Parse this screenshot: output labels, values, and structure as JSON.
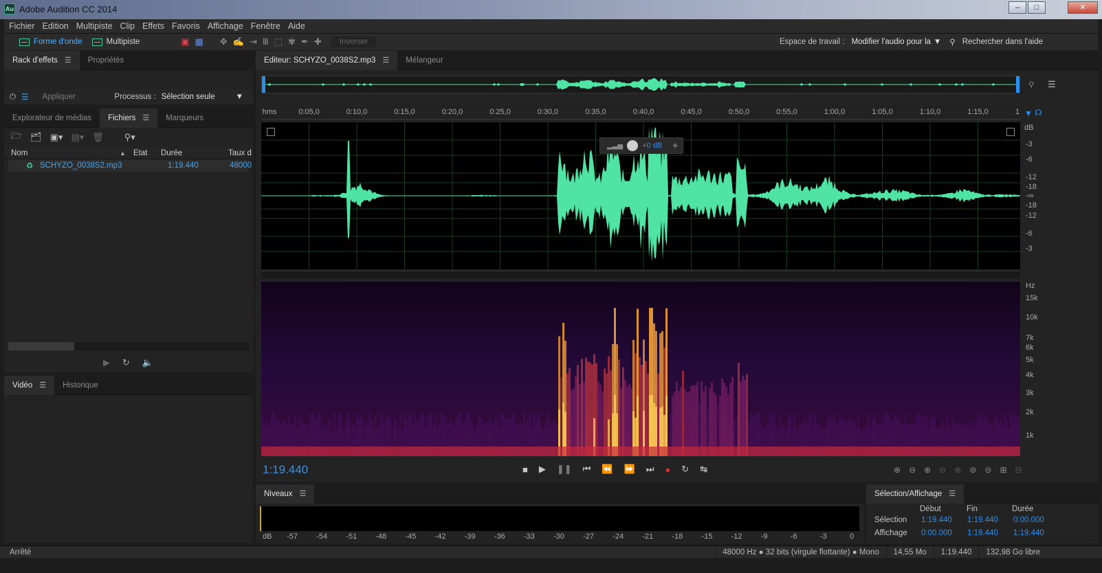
{
  "window": {
    "title": "Adobe Audition CC 2014",
    "icon_text": "Au",
    "controls": [
      "minimize-icon",
      "maximize-icon",
      "close-icon"
    ]
  },
  "menu": [
    "Fichier",
    "Edition",
    "Multipiste",
    "Clip",
    "Effets",
    "Favoris",
    "Affichage",
    "Fenêtre",
    "Aide"
  ],
  "toolbar": {
    "waveform_label": "Forme d'onde",
    "multitrack_label": "Multipiste",
    "invert_label": "Inverser",
    "workspace_label": "Espace de travail :",
    "workspace_value": "Modifier l'audio pour la",
    "help_search": "Rechercher dans l'aide"
  },
  "effects_rack": {
    "tabs": [
      "Rack d'effets",
      "Propriétés"
    ],
    "apply_label": "Appliquer",
    "process_label": "Processus :",
    "process_value": "Sélection seule"
  },
  "files_panel": {
    "tabs": [
      "Explorateur de médias",
      "Fichiers",
      "Marqueurs"
    ],
    "columns": [
      "Nom",
      "Etat",
      "Durée",
      "Taux d"
    ],
    "rows": [
      {
        "name": "SCHYZO_0038S2.mp3",
        "status": "",
        "duration": "1:19.440",
        "rate": "48000"
      }
    ]
  },
  "video_panel": {
    "tabs": [
      "Vidéo",
      "Historique"
    ]
  },
  "editor": {
    "tabs": [
      "Editeur: SCHYZO_0038S2.mp3",
      "Mélangeur"
    ],
    "ruler_unit": "hms",
    "ruler_ticks": [
      "0:05,0",
      "0:10,0",
      "0:15,0",
      "0:20,0",
      "0:25,0",
      "0:30,0",
      "0:35,0",
      "0:40,0",
      "0:45,0",
      "0:50,0",
      "0:55,0",
      "1:00,0",
      "1:05,0",
      "1:10,0",
      "1:15,0",
      "1"
    ],
    "hud_gain": "+0 dB",
    "db_scale": [
      "dB",
      "-3",
      "-6",
      "-12",
      "-18",
      "-∞",
      "-18",
      "-12",
      "-6",
      "-3"
    ],
    "hz_scale": [
      "Hz",
      "15k",
      "10k",
      "7k",
      "6k",
      "5k",
      "4k",
      "3k",
      "2k",
      "1k"
    ],
    "current_time": "1:19.440"
  },
  "levels": {
    "title": "Niveaux",
    "scale": [
      "dB",
      "-57",
      "-54",
      "-51",
      "-48",
      "-45",
      "-42",
      "-39",
      "-36",
      "-33",
      "-30",
      "-27",
      "-24",
      "-21",
      "-18",
      "-15",
      "-12",
      "-9",
      "-6",
      "-3",
      "0"
    ]
  },
  "selection_view": {
    "title": "Sélection/Affichage",
    "columns": [
      "Début",
      "Fin",
      "Durée"
    ],
    "selection": {
      "label": "Sélection",
      "start": "1:19.440",
      "end": "1:19.440",
      "duration": "0:00.000"
    },
    "view": {
      "label": "Affichage",
      "start": "0:00.000",
      "end": "1:19.440",
      "duration": "1:19.440"
    }
  },
  "status": {
    "state": "Arrêté",
    "format": "48000 Hz ● 32 bits (virgule flottante) ● Mono",
    "size": "14,55 Mo",
    "duration": "1:19.440",
    "free": "132,98 Go libre"
  },
  "colors": {
    "accent_blue": "#2b8ff0",
    "waveform_green": "#4fe3a4",
    "record_red": "#d23030"
  }
}
